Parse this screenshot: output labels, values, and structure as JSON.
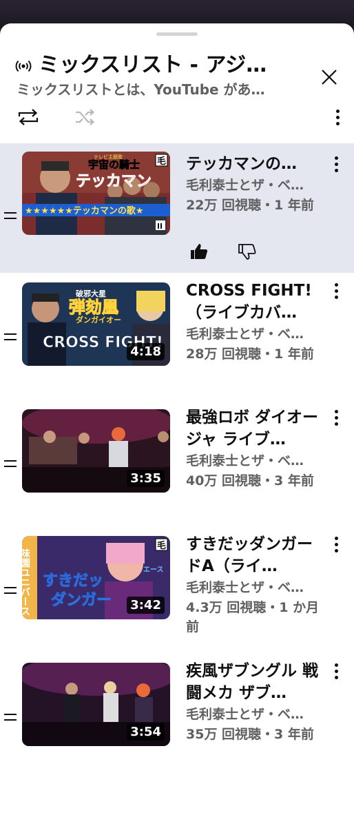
{
  "header": {
    "title": "ミックスリスト - アジ…",
    "subtitle": "ミックスリストとは、YouTube があ…"
  },
  "controls": {
    "loop_icon": "loop-icon",
    "shuffle_icon": "shuffle-icon",
    "more_icon": "more-vert-icon"
  },
  "videos": [
    {
      "title": "テッカマンの…",
      "channel": "毛利泰士とザ・ベ…",
      "meta": "22万 回視聴・1 年前",
      "duration": "",
      "thumb_text_1": "宇宙の騎士",
      "thumb_text_2": "テッカマン",
      "thumb_text_3": "★★★★★★テッカマンの歌★",
      "thumb_text_4": "テレビ主題歌",
      "thumb_badge": "毛",
      "like_icon": "thumbs-up-icon",
      "dislike_icon": "thumbs-down-icon"
    },
    {
      "title": "CROSS FIGHT!（ライブカバ…",
      "channel": "毛利泰士とザ・ベ…",
      "meta": "28万 回視聴・1 年前",
      "duration": "4:18",
      "thumb_text_1": "破邪大星",
      "thumb_text_2": "弾劾凰",
      "thumb_text_3": "ダンガイオー",
      "thumb_text_4": "CROSS FIGHT!"
    },
    {
      "title": "最強ロボ ダイオージャ ライブ…",
      "channel": "毛利泰士とザ・ベ…",
      "meta": "40万 回視聴・3 年前",
      "duration": "3:35"
    },
    {
      "title": "すきだッダンガードA（ライ…",
      "channel": "毛利泰士とザ・ベ…",
      "meta": "4.3万 回視聴・1 か月前",
      "duration": "3:42",
      "thumb_text_1": "味園ユニバース",
      "thumb_text_2": "すきだッ",
      "thumb_text_3": "ダンガー",
      "thumb_text_4": "エース",
      "thumb_badge": "毛"
    },
    {
      "title": "疾風ザブングル 戦闘メカ ザブ…",
      "channel": "毛利泰士とザ・ベ…",
      "meta": "35万 回視聴・3 年前",
      "duration": "3:54"
    }
  ],
  "colors": {
    "active_bg": "#e4e6f0",
    "text_primary": "#0f0f0f",
    "text_secondary": "#606060"
  }
}
